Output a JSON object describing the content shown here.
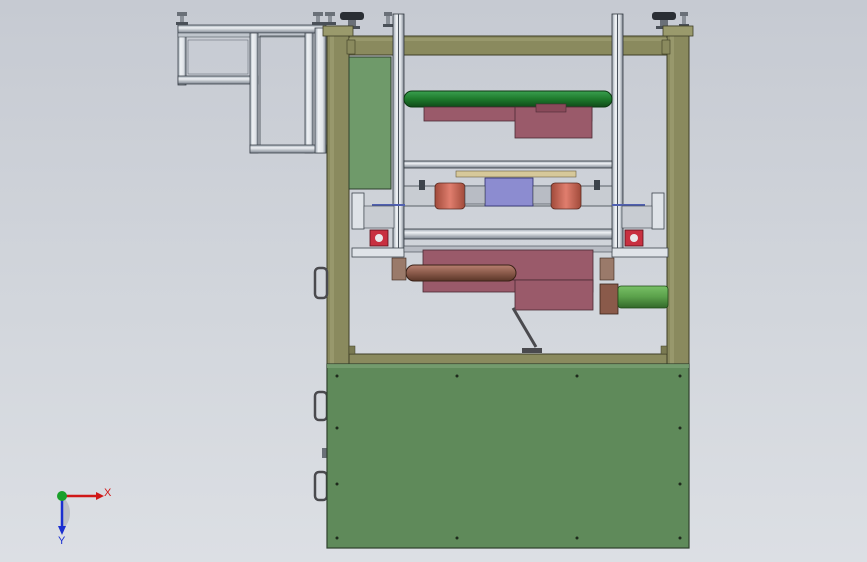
{
  "triad": {
    "x_label": "X",
    "y_label": "Y",
    "x_color": "#d01818",
    "y_color": "#1a2fd0",
    "z_color": "#1aa02a"
  },
  "colors": {
    "frame": "#8a8a5e",
    "frame_edge": "#4a4a30",
    "cabinet": "#5f8a5a",
    "cabinet_edge": "#2e402c",
    "panel": "#6f9a6a",
    "profile": "#dfe3e8",
    "profile_dark": "#5d6570",
    "green_roller": "#1e7a2c",
    "motor_green": "#5aa04a",
    "actuator": "#9a5a6a",
    "red_part": "#c83040",
    "blue_part": "#8080c8",
    "salmon_roller": "#d06a5a",
    "brown_roller": "#8a5a4a"
  }
}
